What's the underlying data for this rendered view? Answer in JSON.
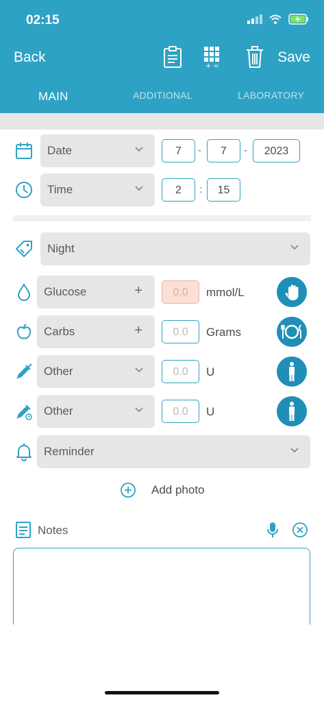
{
  "status_bar": {
    "time": "02:15"
  },
  "nav": {
    "back_label": "Back",
    "save_label": "Save"
  },
  "tabs": [
    {
      "label": "MAIN",
      "active": true
    },
    {
      "label": "ADDITIONAL",
      "active": false
    },
    {
      "label": "LABORATORY",
      "active": false
    }
  ],
  "date": {
    "dropdown_label": "Date",
    "day": "7",
    "month": "7",
    "year": "2023",
    "separator": "-"
  },
  "time": {
    "dropdown_label": "Time",
    "hour": "2",
    "minute": "15",
    "separator": ":"
  },
  "category": {
    "selected": "Night"
  },
  "glucose": {
    "label": "Glucose",
    "value_placeholder": "0.0",
    "unit": "mmol/L"
  },
  "carbs": {
    "label": "Carbs",
    "value_placeholder": "0.0",
    "unit": "Grams"
  },
  "insulin1": {
    "label": "Other",
    "value_placeholder": "0.0",
    "unit": "U"
  },
  "insulin2": {
    "label": "Other",
    "value_placeholder": "0.0",
    "unit": "U"
  },
  "reminder": {
    "label": "Reminder"
  },
  "photo": {
    "add_label": "Add photo"
  },
  "notes": {
    "label": "Notes",
    "value": ""
  },
  "colors": {
    "accent": "#2ea2c4",
    "button_dark": "#1f8fb8",
    "field_bg": "#e6e6e6",
    "warning_bg": "#fbe0d6"
  },
  "icons": [
    "calendar-icon",
    "clock-icon",
    "tag-icon",
    "drop-icon",
    "apple-icon",
    "syringe-icon",
    "pen-icon",
    "bell-icon",
    "plus-circle-icon",
    "notes-icon",
    "mic-icon",
    "clear-icon",
    "hand-icon",
    "plate-icon",
    "person-icon"
  ]
}
